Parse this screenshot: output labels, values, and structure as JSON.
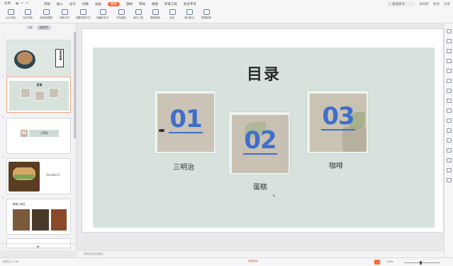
{
  "menubar": {
    "file": "文件",
    "menus": [
      "开始",
      "插入",
      "设计",
      "切换",
      "动画",
      "放映",
      "审阅",
      "视图",
      "开发工具",
      "会员专享"
    ],
    "active_menu": "效率",
    "search": "查找命令",
    "right": [
      "未同步",
      "协作",
      "分享"
    ]
  },
  "ribbon": {
    "buttons": [
      "从头开始",
      "当页开始",
      "演讲者视图",
      "排练计时",
      "设置放映方式",
      "隐藏幻灯片",
      "手机遥控",
      "演示工具",
      "屏幕录制",
      "会议",
      "演示焦点",
      "屏幕放映"
    ]
  },
  "panel": {
    "tabs": [
      "大纲",
      "幻灯片"
    ],
    "active_tab": "幻灯片",
    "add_label": "+"
  },
  "thumbnails": [
    {
      "number": "1",
      "label": "美食专题"
    },
    {
      "number": "2",
      "label": "目录"
    },
    {
      "number": "3",
      "label": "三明治"
    },
    {
      "number": "4",
      "label": "Sandwich"
    },
    {
      "number": "5",
      "label": "推荐三明治"
    }
  ],
  "slide": {
    "title": "目录",
    "items": [
      {
        "number": "01",
        "caption": "三明治"
      },
      {
        "number": "02",
        "caption": "蛋糕"
      },
      {
        "number": "03",
        "caption": "咖啡"
      }
    ]
  },
  "notes": {
    "placeholder": "单击此处添加备注"
  },
  "statusbar": {
    "left": "幻灯片 2 / 16",
    "middle": "智能美化",
    "zoom": "128%"
  },
  "colors": {
    "accent": "#ff6a3d",
    "number_blue": "#3e6fc9",
    "slide_bg": "#d7e2dd"
  }
}
